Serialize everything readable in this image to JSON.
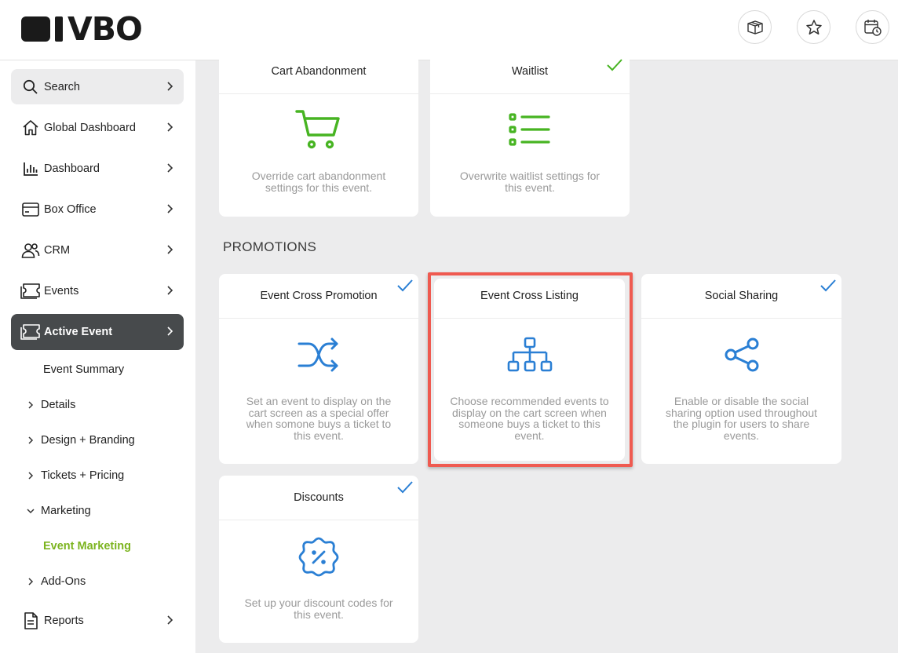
{
  "brand": {
    "logo_text": "VBO"
  },
  "header": {
    "icons": [
      "gift-box-icon",
      "star-icon",
      "calendar-clock-icon"
    ]
  },
  "sidebar": {
    "items": [
      {
        "label": "Search",
        "icon": "search-icon"
      },
      {
        "label": "Global Dashboard",
        "icon": "home-icon"
      },
      {
        "label": "Dashboard",
        "icon": "bar-chart-icon"
      },
      {
        "label": "Box Office",
        "icon": "card-icon"
      },
      {
        "label": "CRM",
        "icon": "users-icon"
      },
      {
        "label": "Events",
        "icon": "ticket-icon"
      },
      {
        "label": "Active Event",
        "icon": "ticket-icon"
      },
      {
        "label": "Reports",
        "icon": "document-icon"
      }
    ],
    "sub_items": [
      {
        "label": "Event Summary"
      },
      {
        "label": "Details"
      },
      {
        "label": "Design + Branding"
      },
      {
        "label": "Tickets + Pricing"
      },
      {
        "label": "Marketing"
      },
      {
        "label": "Event Marketing"
      },
      {
        "label": "Add-Ons"
      }
    ]
  },
  "colors": {
    "accent_green": "#7cb41f",
    "icon_green": "#47b422",
    "icon_blue": "#2a7fd4",
    "highlight_red": "#ef5a50",
    "active_nav": "#474a4c"
  },
  "cards_top": [
    {
      "title": "Cart Abandonment",
      "icon": "cart-icon",
      "desc": "Override cart abandonment settings for this event.",
      "checked": false
    },
    {
      "title": "Waitlist",
      "icon": "list-icon",
      "desc": "Overwrite waitlist settings for this event.",
      "checked": true
    }
  ],
  "section": {
    "title": "PROMOTIONS"
  },
  "promotions": [
    {
      "title": "Event Cross Promotion",
      "icon": "shuffle-icon",
      "desc": "Set an event to display on the cart screen as a special offer when somone buys a ticket to this event.",
      "checked": true
    },
    {
      "title": "Event Cross Listing",
      "icon": "hierarchy-icon",
      "desc": "Choose recommended events to display on the cart screen when someone buys a ticket to this event.",
      "checked": false
    },
    {
      "title": "Social Sharing",
      "icon": "share-icon",
      "desc": "Enable or disable the social sharing option used throughout the plugin for users to share events.",
      "checked": true
    },
    {
      "title": "Discounts",
      "icon": "discount-badge-icon",
      "desc": "Set up your discount codes for this event.",
      "checked": true
    }
  ]
}
